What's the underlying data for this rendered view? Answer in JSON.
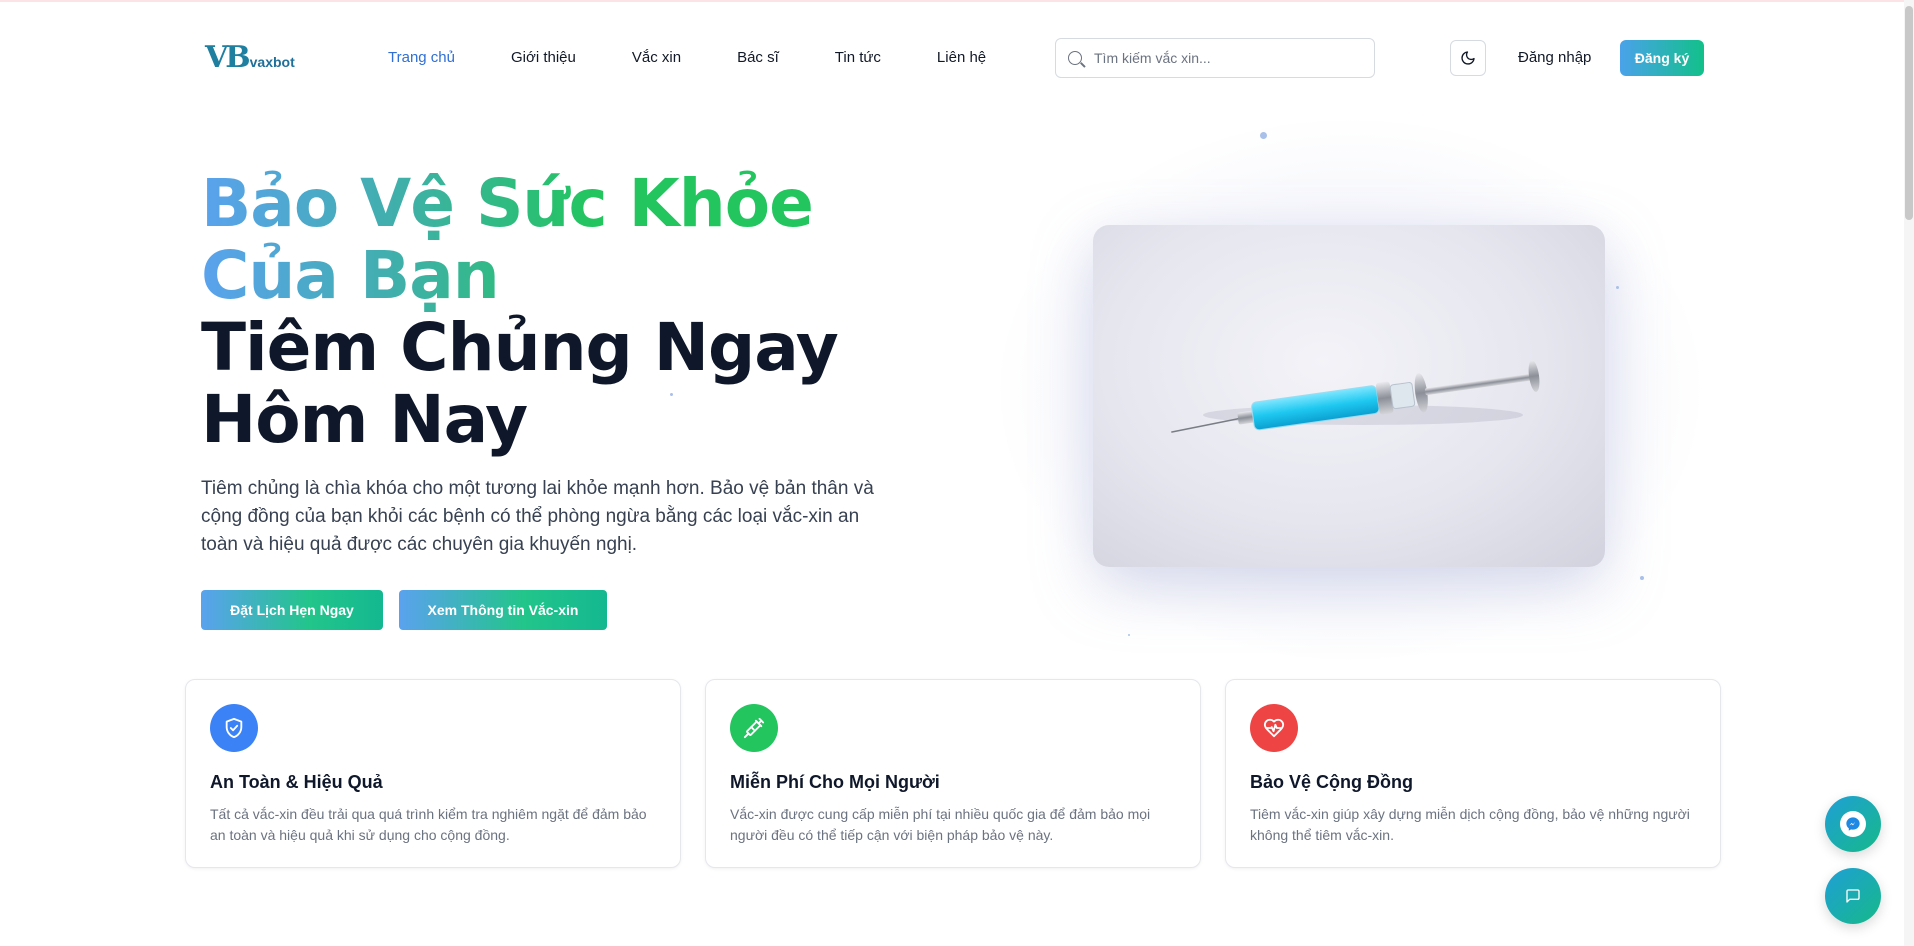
{
  "header": {
    "logo_mark": "VB",
    "logo_text": "vaxbot",
    "nav": [
      {
        "label": "Trang chủ",
        "active": true
      },
      {
        "label": "Giới thiệu",
        "active": false
      },
      {
        "label": "Vắc xin",
        "active": false
      },
      {
        "label": "Bác sĩ",
        "active": false
      },
      {
        "label": "Tin tức",
        "active": false
      },
      {
        "label": "Liên hệ",
        "active": false
      }
    ],
    "search_placeholder": "Tìm kiếm vắc xin...",
    "theme_icon": "moon-icon",
    "login_label": "Đăng nhập",
    "register_label": "Đăng ký"
  },
  "hero": {
    "title_line1": "Bảo Vệ Sức Khỏe",
    "title_line2": "Của Bạn",
    "title_line3": "Tiêm Chủng Ngay",
    "title_line4": "Hôm Nay",
    "description": "Tiêm chủng là chìa khóa cho một tương lai khỏe mạnh hơn. Bảo vệ bản thân và cộng đồng của bạn khỏi các bệnh có thể phòng ngừa bằng các loại vắc-xin an toàn và hiệu quả được các chuyên gia khuyến nghị.",
    "primary_button": "Đặt Lịch Hẹn Ngay",
    "secondary_button": "Xem Thông tin Vắc-xin",
    "image_icon": "syringe-image"
  },
  "features": [
    {
      "icon": "shield-check-icon",
      "color": "#3b82f6",
      "title": "An Toàn & Hiệu Quả",
      "description": "Tất cả vắc-xin đều trải qua quá trình kiểm tra nghiêm ngặt để đảm bảo an toàn và hiệu quả khi sử dụng cho cộng đồng."
    },
    {
      "icon": "syringe-icon",
      "color": "#22c55e",
      "title": "Miễn Phí Cho Mọi Người",
      "description": "Vắc-xin được cung cấp miễn phí tại nhiều quốc gia để đảm bảo mọi người đều có thể tiếp cận với biện pháp bảo vệ này."
    },
    {
      "icon": "heart-pulse-icon",
      "color": "#ef4444",
      "title": "Bảo Vệ Cộng Đồng",
      "description": "Tiêm vắc-xin giúp xây dựng miễn dịch cộng đồng, bảo vệ những người không thể tiêm vắc-xin."
    }
  ],
  "floating": {
    "messenger_icon": "messenger-icon",
    "chat_icon": "chat-icon"
  },
  "colors": {
    "accent_blue": "#2f6fd6",
    "gradient_start": "#4aa2ea",
    "gradient_end": "#12c08a",
    "text_dark": "#0f172a"
  }
}
